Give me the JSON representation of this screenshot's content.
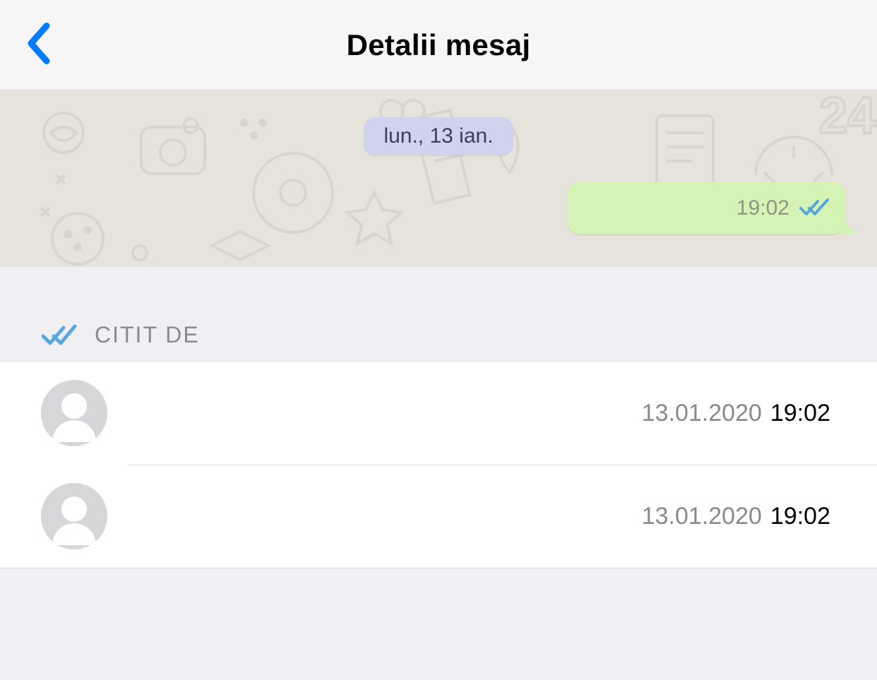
{
  "header": {
    "title": "Detalii mesaj"
  },
  "chat": {
    "date_pill": "lun., 13 ian.",
    "bubble_time": "19:02"
  },
  "read_section": {
    "label": "CITIT DE",
    "rows": [
      {
        "date": "13.01.2020",
        "time": "19:02"
      },
      {
        "date": "13.01.2020",
        "time": "19:02"
      }
    ]
  }
}
